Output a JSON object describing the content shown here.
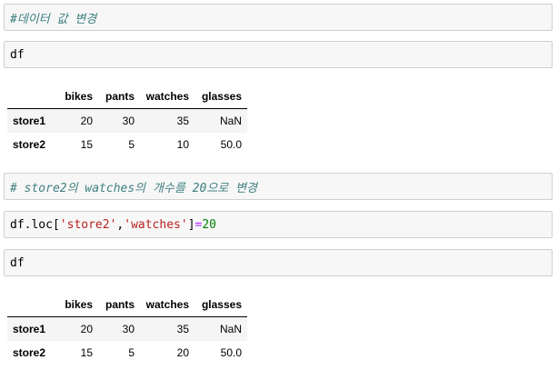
{
  "cells": {
    "c1_comment": "#데이터 값 변경",
    "c2_code": "df",
    "c3_comment": "# store2의 watches의 개수를 20으로 변경",
    "c4": {
      "prefix": "df.loc[",
      "str1": "'store2'",
      "comma": ",",
      "str2": "'watches'",
      "close": "]",
      "eq": "=",
      "num": "20"
    },
    "c5_code": "df"
  },
  "table1": {
    "columns": [
      "bikes",
      "pants",
      "watches",
      "glasses"
    ],
    "rows": [
      {
        "index": "store1",
        "values": [
          "20",
          "30",
          "35",
          "NaN"
        ]
      },
      {
        "index": "store2",
        "values": [
          "15",
          "5",
          "10",
          "50.0"
        ]
      }
    ]
  },
  "table2": {
    "columns": [
      "bikes",
      "pants",
      "watches",
      "glasses"
    ],
    "rows": [
      {
        "index": "store1",
        "values": [
          "20",
          "30",
          "35",
          "NaN"
        ]
      },
      {
        "index": "store2",
        "values": [
          "15",
          "5",
          "20",
          "50.0"
        ]
      }
    ]
  }
}
